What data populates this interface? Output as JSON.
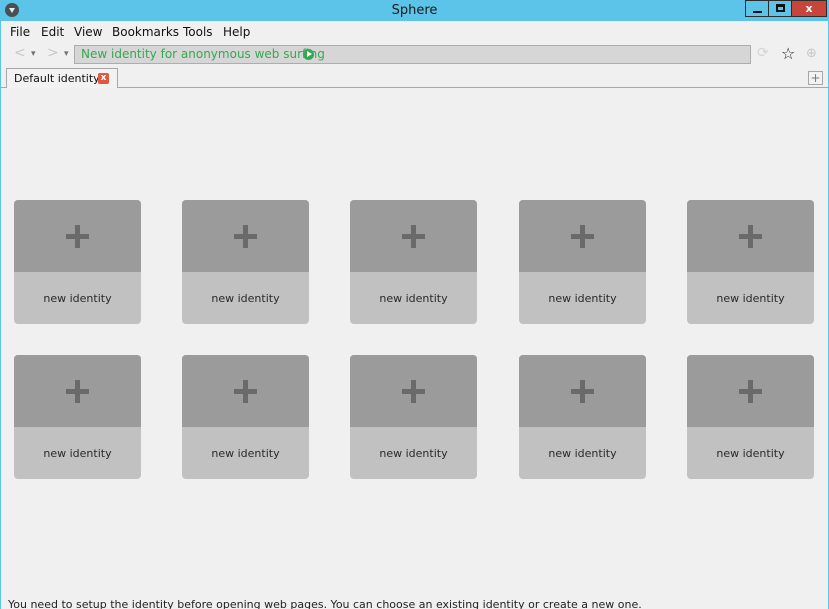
{
  "window": {
    "title": "Sphere",
    "controls": {
      "minimize": "",
      "maximize": "",
      "close": "x"
    }
  },
  "menu": [
    "File",
    "Edit",
    "View",
    "Bookmarks",
    "Tools",
    "Help"
  ],
  "toolbar": {
    "back_icon": "<",
    "dropdown_icon": "▾",
    "forward_icon": ">",
    "history_icon": "▾",
    "url_text": "New identity for anonymous web surfing",
    "reload_icon": "⟳",
    "bookmark_icon": "☆",
    "extension_icon": "⊕"
  },
  "tabs": [
    {
      "label": "Default identity",
      "close": "x"
    }
  ],
  "new_tab_label": "+",
  "identity_cards": [
    {
      "label": "new identity"
    },
    {
      "label": "new identity"
    },
    {
      "label": "new identity"
    },
    {
      "label": "new identity"
    },
    {
      "label": "new identity"
    },
    {
      "label": "new identity"
    },
    {
      "label": "new identity"
    },
    {
      "label": "new identity"
    },
    {
      "label": "new identity"
    },
    {
      "label": "new identity"
    }
  ],
  "status_text": "You need to setup the identity before opening web pages. You can choose an existing identity or create a new one.",
  "colors": {
    "titlebar": "#5bc4e8",
    "close_button": "#c7453a",
    "url_text": "#35a852",
    "card_top": "#9b9b9b",
    "card_bottom": "#c1c1c1"
  }
}
